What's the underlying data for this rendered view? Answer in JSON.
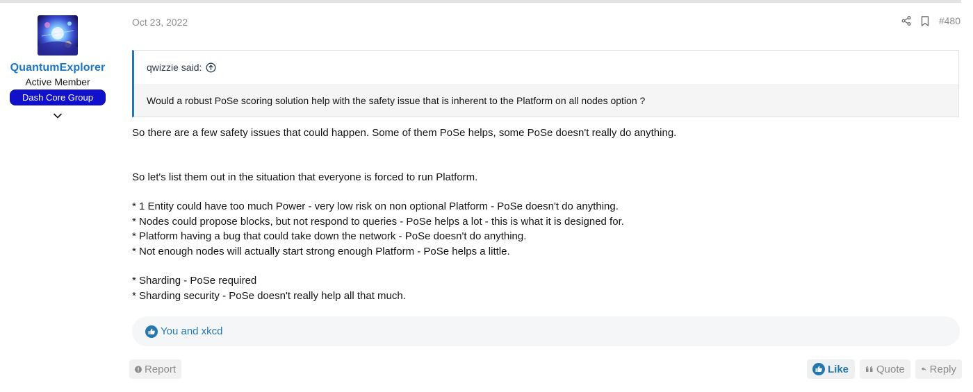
{
  "post": {
    "date": "Oct 23, 2022",
    "number": "#480"
  },
  "user": {
    "name": "QuantumExplorer",
    "title": "Active Member",
    "badge": "Dash Core Group",
    "avatar_icon": "avatar-image"
  },
  "quote": {
    "author": "qwizzie said:",
    "text": "Would a robust PoSe scoring solution help with the safety issue that is inherent to the Platform on all nodes option ?"
  },
  "message": {
    "paragraphs": [
      "So there are a few safety issues that could happen. Some of them PoSe helps, some PoSe doesn't really do anything.",
      "So let's list them out in the situation that everyone is forced to run Platform.",
      "* 1 Entity could have too much Power - very low risk on non optional Platform - PoSe doesn't do anything.",
      "* Nodes could propose blocks, but not respond to queries - PoSe helps a lot - this is what it is designed for.",
      "* Platform having a bug that could take down the network - PoSe doesn't do anything.",
      "* Not enough nodes will actually start strong enough Platform - PoSe helps a little.",
      "* Sharding - PoSe required",
      "* Sharding security - PoSe doesn't really help all that much."
    ]
  },
  "reactions": {
    "text": "You and xkcd",
    "icon": "thumbs-up-icon"
  },
  "actions": {
    "report": "Report",
    "like": "Like",
    "quote": "Quote",
    "reply": "Reply"
  },
  "colors": {
    "accent": "#2577b1",
    "username": "#1b77c4",
    "badge_bg": "#1111cc",
    "muted": "#8c8c8c"
  }
}
